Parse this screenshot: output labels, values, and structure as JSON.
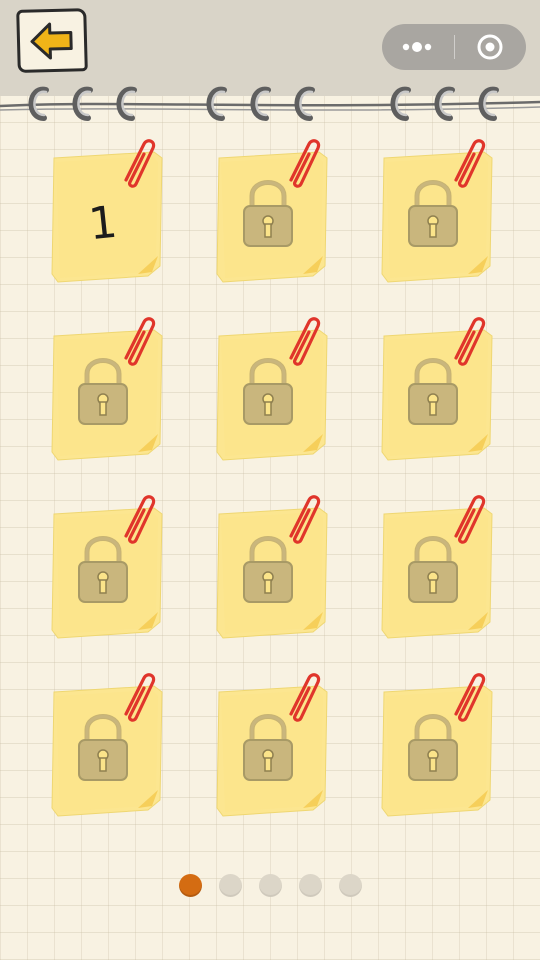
{
  "header": {
    "back_icon": "left-arrow-icon",
    "capsule": {
      "more_icon": "more-dots-icon",
      "close_icon": "target-circle-icon"
    }
  },
  "levels": [
    {
      "number": "1",
      "locked": false
    },
    {
      "number": "",
      "locked": true
    },
    {
      "number": "",
      "locked": true
    },
    {
      "number": "",
      "locked": true
    },
    {
      "number": "",
      "locked": true
    },
    {
      "number": "",
      "locked": true
    },
    {
      "number": "",
      "locked": true
    },
    {
      "number": "",
      "locked": true
    },
    {
      "number": "",
      "locked": true
    },
    {
      "number": "",
      "locked": true
    },
    {
      "number": "",
      "locked": true
    },
    {
      "number": "",
      "locked": true
    }
  ],
  "pagination": {
    "pages": 5,
    "current": 1
  },
  "colors": {
    "note_yellow": "#fce690",
    "paperclip_red": "#e0352b",
    "lock": "#c9b67d",
    "active_dot": "#d46c12",
    "inactive_dot": "#dcd6c8"
  }
}
